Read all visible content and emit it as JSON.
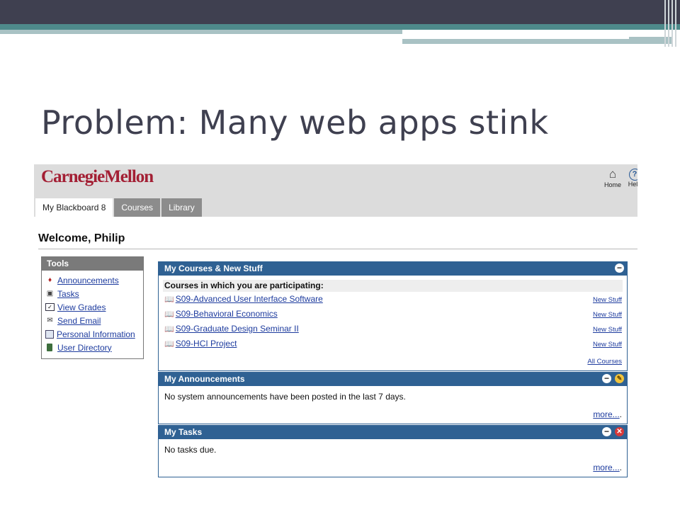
{
  "slide": {
    "title": "Problem: Many web apps stink"
  },
  "app": {
    "logo": "CarnegieMellon",
    "util": {
      "home_label": "Home",
      "help_label": "Help",
      "home_icon": "home-icon",
      "help_icon": "help-icon"
    },
    "tabs": [
      {
        "label": "My Blackboard 8",
        "active": true
      },
      {
        "label": "Courses",
        "active": false
      },
      {
        "label": "Library",
        "active": false
      }
    ],
    "welcome": "Welcome, Philip",
    "tools": {
      "title": "Tools",
      "items": [
        {
          "label": "Announcements",
          "icon": "announcement-icon"
        },
        {
          "label": "Tasks",
          "icon": "tasks-icon"
        },
        {
          "label": "View Grades",
          "icon": "grades-icon"
        },
        {
          "label": "Send Email",
          "icon": "email-icon"
        },
        {
          "label": "Personal Information",
          "icon": "person-icon"
        },
        {
          "label": "User Directory",
          "icon": "directory-icon"
        }
      ]
    },
    "courses_module": {
      "title": "My Courses & New Stuff",
      "subheading": "Courses in which you are participating:",
      "courses": [
        {
          "name": "S09-Advanced User Interface Software",
          "link": "New Stuff"
        },
        {
          "name": "S09-Behavioral Economics",
          "link": "New Stuff"
        },
        {
          "name": "S09-Graduate Design Seminar II",
          "link": "New Stuff"
        },
        {
          "name": "S09-HCI Project",
          "link": "New Stuff"
        }
      ],
      "all_courses": "All Courses"
    },
    "announcements_module": {
      "title": "My Announcements",
      "body": "No system announcements have been posted in the last 7 days.",
      "more": "more...",
      "more_dots": "."
    },
    "tasks_module": {
      "title": "My Tasks",
      "body": "No tasks due.",
      "more": "more...",
      "more_dots": "."
    }
  }
}
